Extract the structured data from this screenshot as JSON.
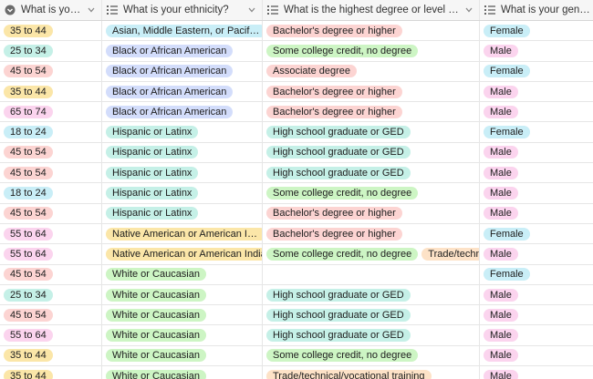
{
  "columns": [
    {
      "label": "What is your age…",
      "icon": "circle-chevron-icon"
    },
    {
      "label": "What is your ethnicity?",
      "icon": "multi-select-icon"
    },
    {
      "label": "What is the highest degree or level of school …",
      "icon": "multi-select-icon"
    },
    {
      "label": "What is your gender?",
      "icon": "multi-select-icon"
    }
  ],
  "colors": {
    "orange": "#fde2c7",
    "cyan": "#c9eef7",
    "red": "#fcd4d2",
    "yellow": "#fbe6a8",
    "pink": "#fbd4ee",
    "blue": "#d3ddfb",
    "teal": "#c5f0e7",
    "green": "#cdf5c4"
  },
  "rows": [
    {
      "age": {
        "text": "35 to 44",
        "color": "yellow"
      },
      "eth": [
        {
          "text": "Asian, Middle Eastern, or Pacific Is...",
          "color": "cyan"
        }
      ],
      "deg": [
        {
          "text": "Bachelor's degree or higher",
          "color": "red"
        }
      ],
      "gender": {
        "text": "Female",
        "color": "cyan"
      }
    },
    {
      "age": {
        "text": "25 to 34",
        "color": "teal"
      },
      "eth": [
        {
          "text": "Black or African American",
          "color": "blue"
        }
      ],
      "deg": [
        {
          "text": "Some college credit, no degree",
          "color": "green"
        }
      ],
      "gender": {
        "text": "Male",
        "color": "pink"
      }
    },
    {
      "age": {
        "text": "45 to 54",
        "color": "red"
      },
      "eth": [
        {
          "text": "Black or African American",
          "color": "blue"
        }
      ],
      "deg": [
        {
          "text": "Associate degree",
          "color": "red"
        }
      ],
      "gender": {
        "text": "Female",
        "color": "cyan"
      }
    },
    {
      "age": {
        "text": "35 to 44",
        "color": "yellow"
      },
      "eth": [
        {
          "text": "Black or African American",
          "color": "blue"
        }
      ],
      "deg": [
        {
          "text": "Bachelor's degree or higher",
          "color": "red"
        }
      ],
      "gender": {
        "text": "Male",
        "color": "pink"
      }
    },
    {
      "age": {
        "text": "65 to 74",
        "color": "pink"
      },
      "eth": [
        {
          "text": "Black or African American",
          "color": "blue"
        }
      ],
      "deg": [
        {
          "text": "Bachelor's degree or higher",
          "color": "red"
        }
      ],
      "gender": {
        "text": "Male",
        "color": "pink"
      }
    },
    {
      "age": {
        "text": "18 to 24",
        "color": "cyan"
      },
      "eth": [
        {
          "text": "Hispanic or Latinx",
          "color": "teal"
        }
      ],
      "deg": [
        {
          "text": "High school graduate or GED",
          "color": "teal"
        }
      ],
      "gender": {
        "text": "Female",
        "color": "cyan"
      }
    },
    {
      "age": {
        "text": "45 to 54",
        "color": "red"
      },
      "eth": [
        {
          "text": "Hispanic or Latinx",
          "color": "teal"
        }
      ],
      "deg": [
        {
          "text": "High school graduate or GED",
          "color": "teal"
        }
      ],
      "gender": {
        "text": "Male",
        "color": "pink"
      }
    },
    {
      "age": {
        "text": "45 to 54",
        "color": "red"
      },
      "eth": [
        {
          "text": "Hispanic or Latinx",
          "color": "teal"
        }
      ],
      "deg": [
        {
          "text": "High school graduate or GED",
          "color": "teal"
        }
      ],
      "gender": {
        "text": "Male",
        "color": "pink"
      }
    },
    {
      "age": {
        "text": "18 to 24",
        "color": "cyan"
      },
      "eth": [
        {
          "text": "Hispanic or Latinx",
          "color": "teal"
        }
      ],
      "deg": [
        {
          "text": "Some college credit, no degree",
          "color": "green"
        }
      ],
      "gender": {
        "text": "Male",
        "color": "pink"
      }
    },
    {
      "age": {
        "text": "45 to 54",
        "color": "red"
      },
      "eth": [
        {
          "text": "Hispanic or Latinx",
          "color": "teal"
        }
      ],
      "deg": [
        {
          "text": "Bachelor's degree or higher",
          "color": "red"
        }
      ],
      "gender": {
        "text": "Male",
        "color": "pink"
      }
    },
    {
      "age": {
        "text": "55 to 64",
        "color": "pink"
      },
      "eth": [
        {
          "text": "Native American or American Indian",
          "color": "yellow"
        }
      ],
      "deg": [
        {
          "text": "Bachelor's degree or higher",
          "color": "red"
        }
      ],
      "gender": {
        "text": "Female",
        "color": "cyan"
      }
    },
    {
      "age": {
        "text": "55 to 64",
        "color": "pink"
      },
      "eth": [
        {
          "text": "Native American or American Indian",
          "color": "yellow"
        },
        {
          "text": "",
          "color": "green"
        }
      ],
      "deg": [
        {
          "text": "Some college credit, no degree",
          "color": "green"
        },
        {
          "text": "Trade/technical/vo",
          "color": "orange"
        }
      ],
      "gender": {
        "text": "Male",
        "color": "pink"
      }
    },
    {
      "age": {
        "text": "45 to 54",
        "color": "red"
      },
      "eth": [
        {
          "text": "White or Caucasian",
          "color": "green"
        }
      ],
      "deg": [],
      "gender": {
        "text": "Female",
        "color": "cyan"
      }
    },
    {
      "age": {
        "text": "25 to 34",
        "color": "teal"
      },
      "eth": [
        {
          "text": "White or Caucasian",
          "color": "green"
        }
      ],
      "deg": [
        {
          "text": "High school graduate or GED",
          "color": "teal"
        }
      ],
      "gender": {
        "text": "Male",
        "color": "pink"
      }
    },
    {
      "age": {
        "text": "45 to 54",
        "color": "red"
      },
      "eth": [
        {
          "text": "White or Caucasian",
          "color": "green"
        }
      ],
      "deg": [
        {
          "text": "High school graduate or GED",
          "color": "teal"
        }
      ],
      "gender": {
        "text": "Male",
        "color": "pink"
      }
    },
    {
      "age": {
        "text": "55 to 64",
        "color": "pink"
      },
      "eth": [
        {
          "text": "White or Caucasian",
          "color": "green"
        }
      ],
      "deg": [
        {
          "text": "High school graduate or GED",
          "color": "teal"
        }
      ],
      "gender": {
        "text": "Male",
        "color": "pink"
      }
    },
    {
      "age": {
        "text": "35 to 44",
        "color": "yellow"
      },
      "eth": [
        {
          "text": "White or Caucasian",
          "color": "green"
        }
      ],
      "deg": [
        {
          "text": "Some college credit, no degree",
          "color": "green"
        }
      ],
      "gender": {
        "text": "Male",
        "color": "pink"
      }
    },
    {
      "age": {
        "text": "35 to 44",
        "color": "yellow"
      },
      "eth": [
        {
          "text": "White or Caucasian",
          "color": "green"
        }
      ],
      "deg": [
        {
          "text": "Trade/technical/vocational training",
          "color": "orange"
        }
      ],
      "gender": {
        "text": "Male",
        "color": "pink"
      }
    }
  ]
}
